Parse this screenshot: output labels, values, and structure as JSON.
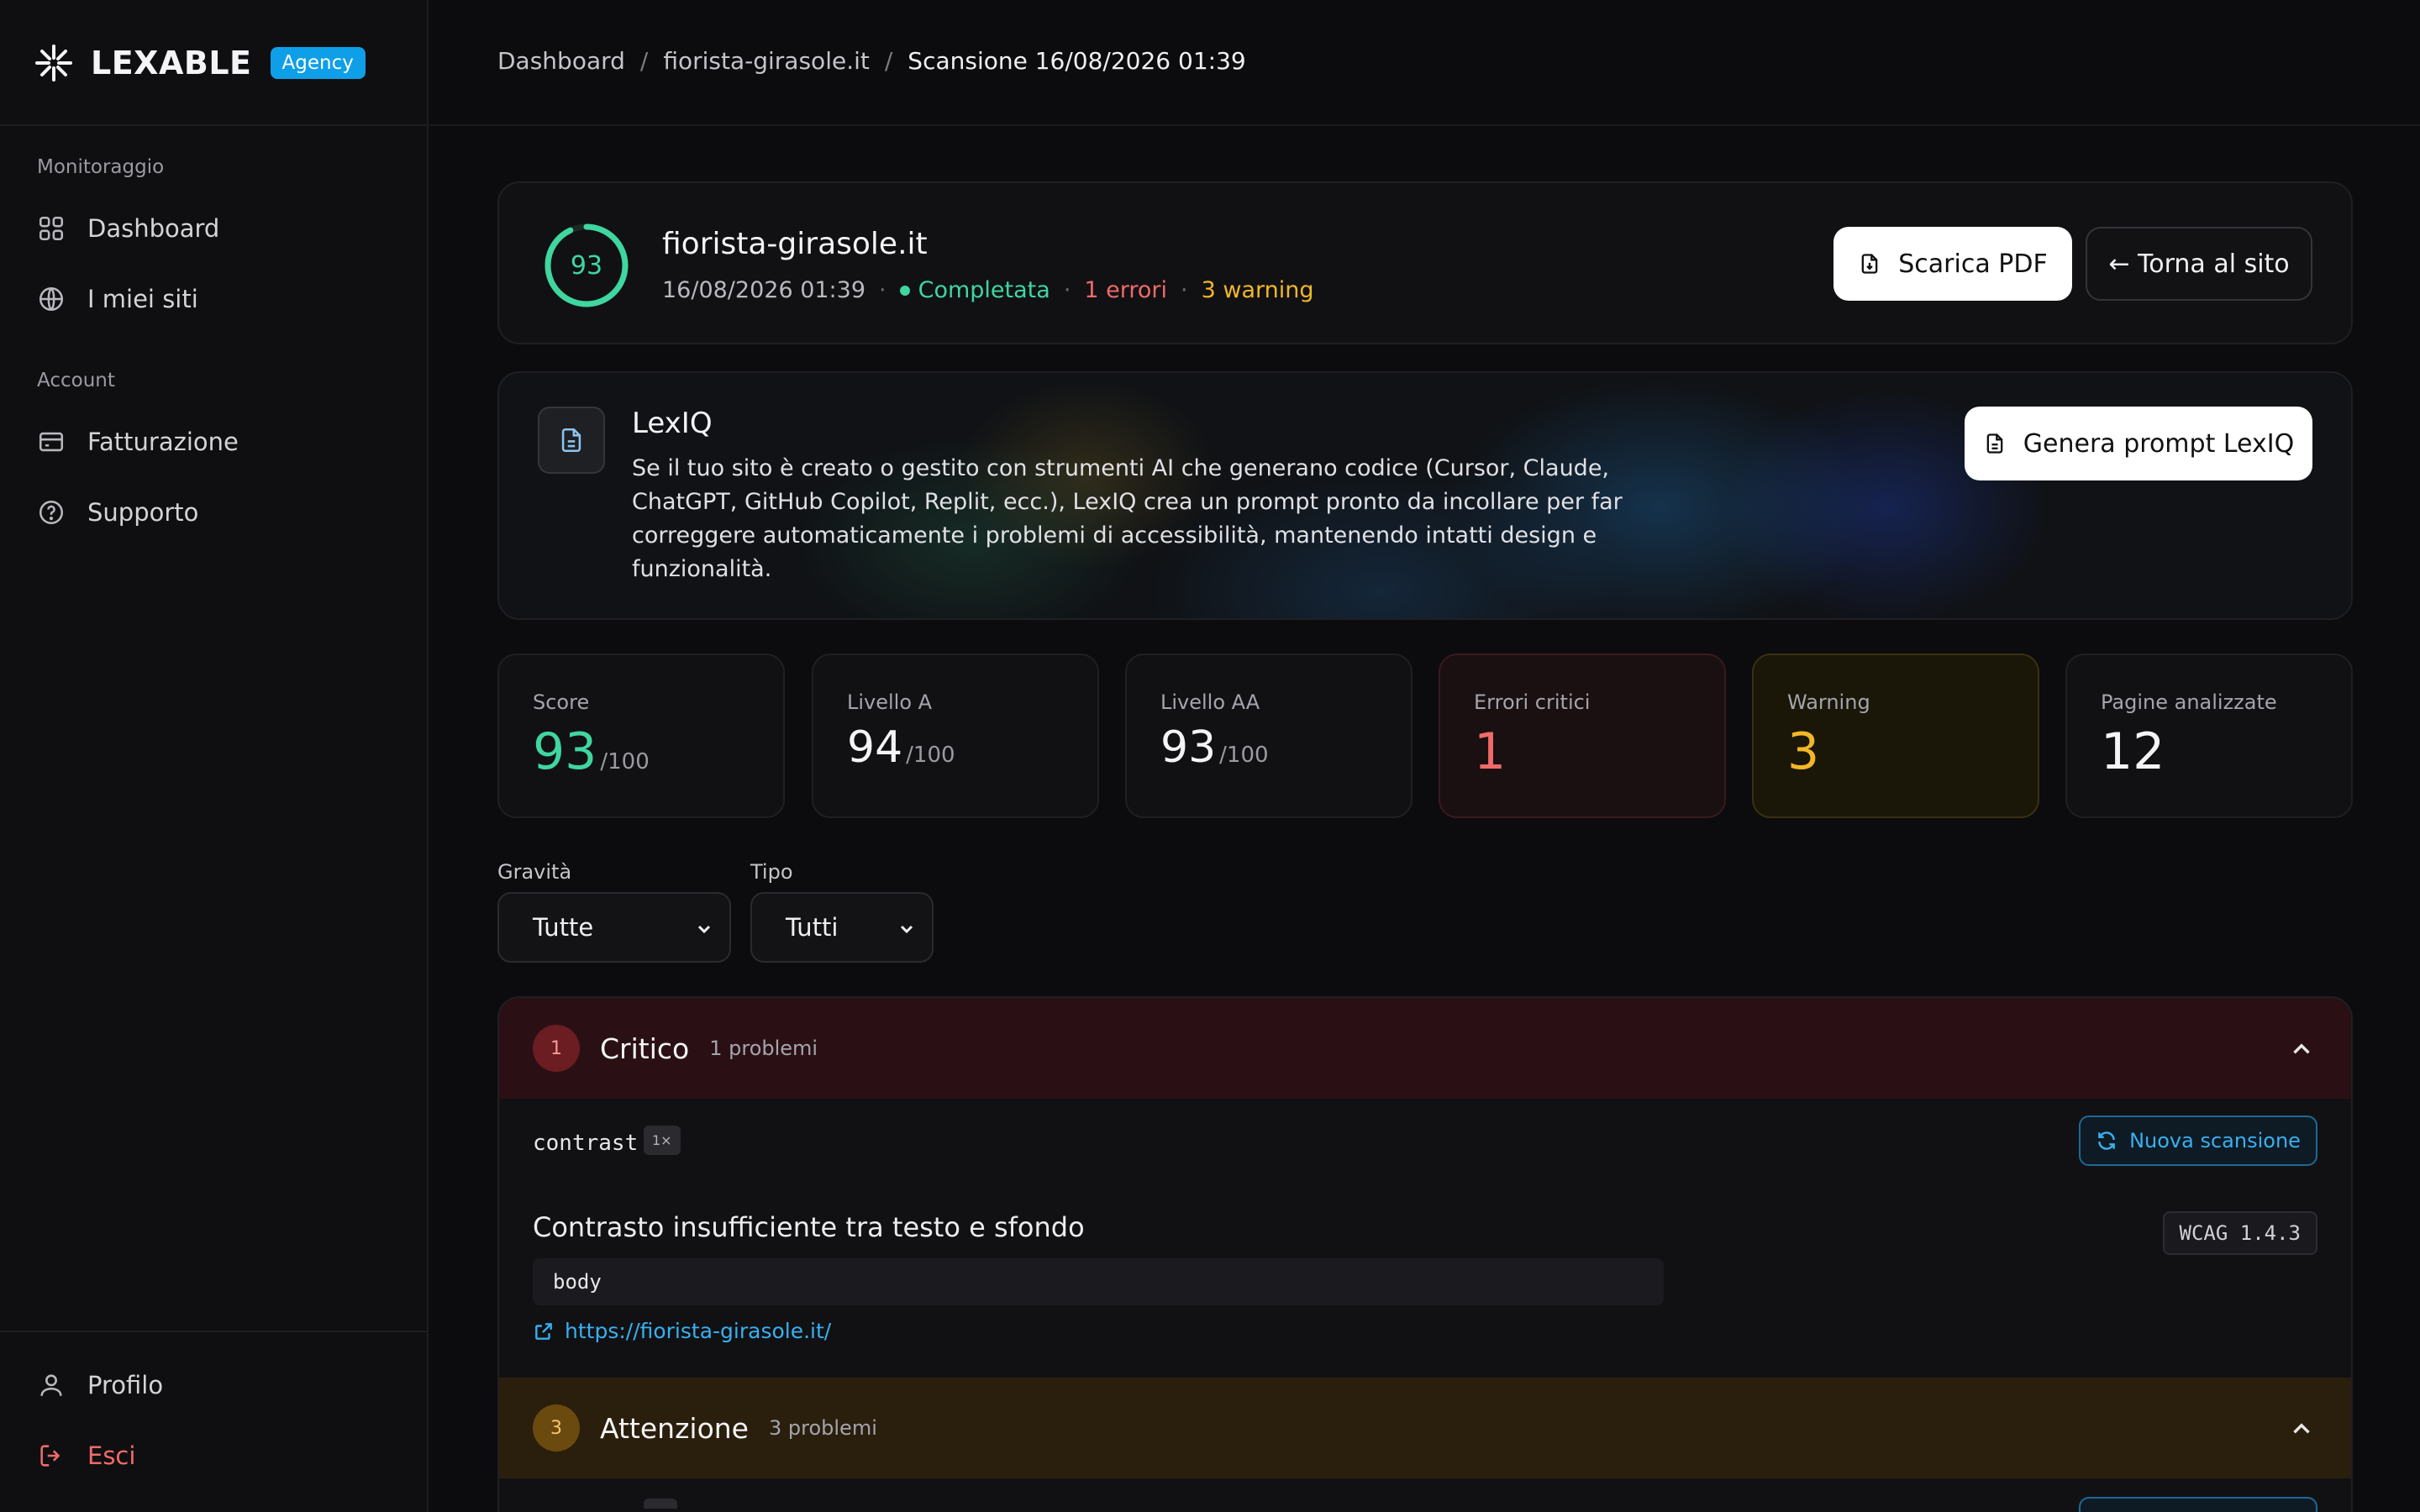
{
  "brand": {
    "name": "LEXABLE",
    "badge": "Agency"
  },
  "sidebar": {
    "sections": [
      {
        "label": "Monitoraggio",
        "items": [
          {
            "label": "Dashboard",
            "icon": "grid-icon"
          },
          {
            "label": "I miei siti",
            "icon": "globe-icon"
          }
        ]
      },
      {
        "label": "Account",
        "items": [
          {
            "label": "Fatturazione",
            "icon": "credit-card-icon"
          },
          {
            "label": "Supporto",
            "icon": "help-circle-icon"
          }
        ]
      }
    ],
    "footer": [
      {
        "label": "Profilo",
        "icon": "user-icon"
      },
      {
        "label": "Esci",
        "icon": "logout-icon",
        "color": "#f16a6a"
      }
    ]
  },
  "breadcrumb": {
    "items": [
      "Dashboard",
      "fiorista-girasole.it"
    ],
    "current": "Scansione 16/08/2026 01:39",
    "separator": "/"
  },
  "site": {
    "score": "93",
    "score_fraction": 0.93,
    "name": "fiorista-girasole.it",
    "date": "16/08/2026 01:39",
    "status": "Completata",
    "errors": "1 errori",
    "warnings": "3 warning",
    "download_label": "Scarica PDF",
    "back_label": "← Torna al sito"
  },
  "lexiq": {
    "title": "LexIQ",
    "description": "Se il tuo sito è creato o gestito con strumenti AI che generano codice (Cursor, Claude, ChatGPT, GitHub Copilot, Replit, ecc.), LexIQ crea un prompt pronto da incollare per far correggere automaticamente i problemi di accessibilità, mantenendo intatti design e funzionalità.",
    "button_label": "Genera prompt LexIQ"
  },
  "stats": [
    {
      "label": "Score",
      "value": "93",
      "unit": "/100",
      "color": "#3fd6a0"
    },
    {
      "label": "Livello A",
      "value": "94",
      "unit": "/100",
      "color": "#f4f4f6"
    },
    {
      "label": "Livello AA",
      "value": "93",
      "unit": "/100",
      "color": "#f4f4f6"
    },
    {
      "label": "Errori critici",
      "value": "1",
      "unit": "",
      "color": "#f16a6a"
    },
    {
      "label": "Warning",
      "value": "3",
      "unit": "",
      "color": "#f2b728"
    },
    {
      "label": "Pagine analizzate",
      "value": "12",
      "unit": "",
      "color": "#f4f4f6"
    }
  ],
  "filters": {
    "severity": {
      "label": "Gravità",
      "value": "Tutte"
    },
    "type": {
      "label": "Tipo",
      "value": "Tutti"
    }
  },
  "groups": {
    "critical": {
      "count": "1",
      "title": "Critico",
      "count_label": "1 problemi",
      "color": "#f16a6a"
    },
    "warning": {
      "count": "3",
      "title": "Attenzione",
      "count_label": "3 problemi",
      "color": "#f2b728"
    }
  },
  "issue": {
    "rule": "contrast",
    "occurrences": "1×",
    "rescan_label": "Nuova scansione",
    "title": "Contrasto insufficiente tra testo e sfondo",
    "wcag": "WCAG 1.4.3",
    "selector": "body",
    "url": "https://fiorista-girasole.it/"
  }
}
